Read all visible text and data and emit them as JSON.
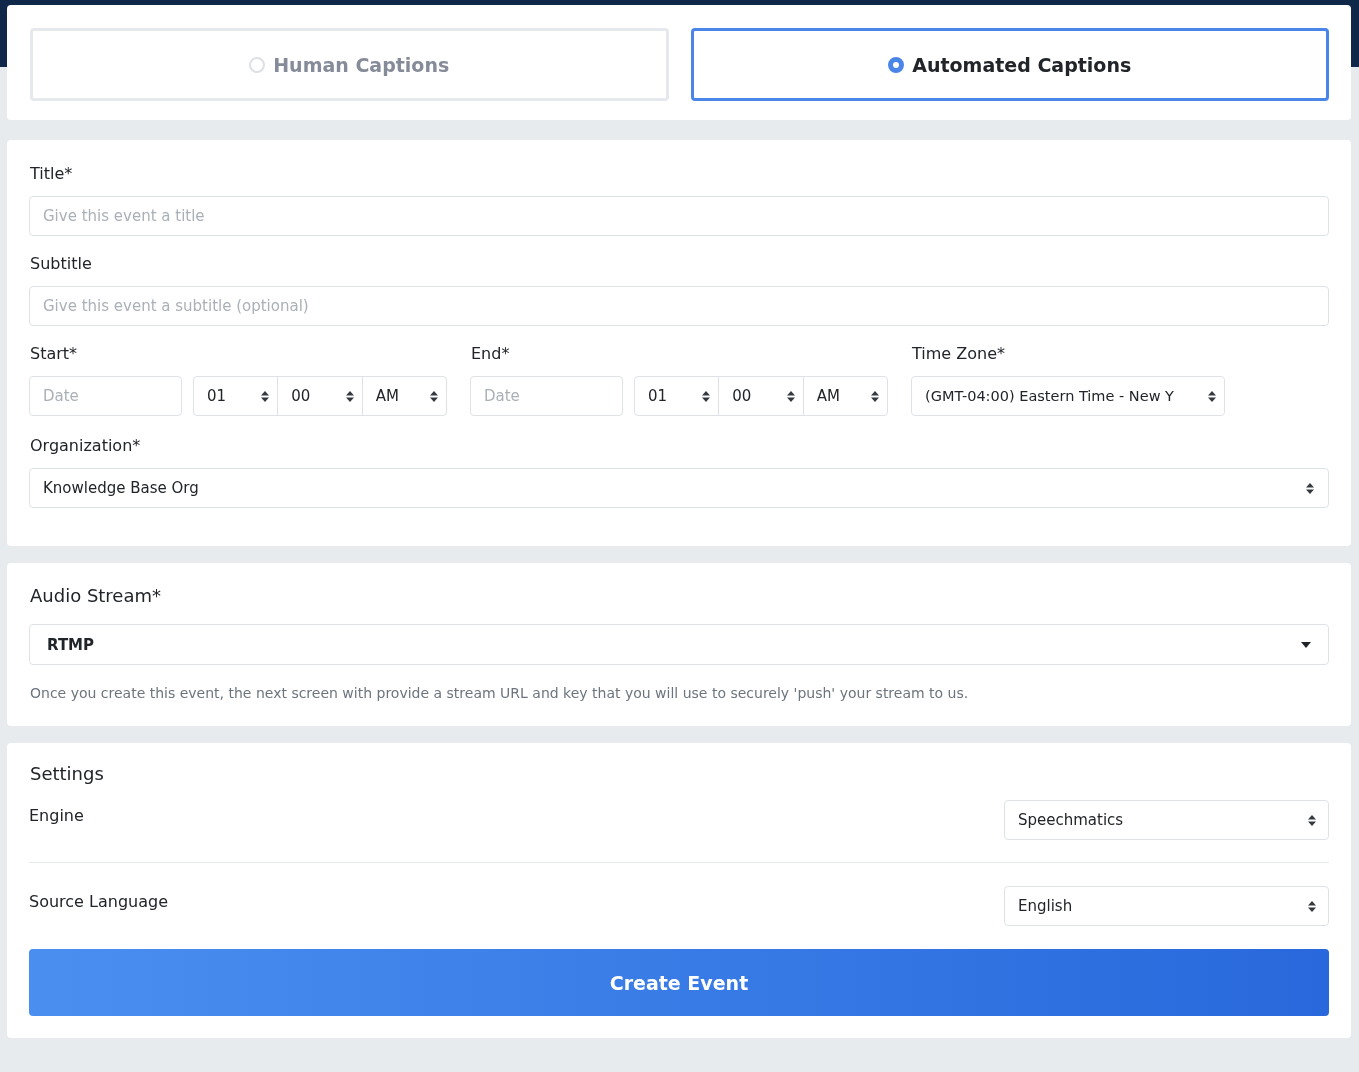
{
  "caption_types": [
    {
      "label": "Human Captions",
      "selected": false
    },
    {
      "label": "Automated Captions",
      "selected": true
    }
  ],
  "details": {
    "title": {
      "label": "Title*",
      "placeholder": "Give this event a title"
    },
    "subtitle": {
      "label": "Subtitle",
      "placeholder": "Give this event a subtitle (optional)"
    },
    "start": {
      "label": "Start*",
      "date_placeholder": "Date",
      "hour": "01",
      "minute": "00",
      "period": "AM"
    },
    "end": {
      "label": "End*",
      "date_placeholder": "Date",
      "hour": "01",
      "minute": "00",
      "period": "AM"
    },
    "time_zone": {
      "label": "Time Zone*",
      "value": "(GMT-04:00) Eastern Time - New Y"
    },
    "organization": {
      "label": "Organization*",
      "value": "Knowledge Base Org"
    }
  },
  "audio_stream": {
    "heading": "Audio Stream*",
    "value": "RTMP",
    "help": "Once you create this event, the next screen with provide a stream URL and key that you will use to securely 'push' your stream to us."
  },
  "settings": {
    "heading": "Settings",
    "rows": [
      {
        "label": "Engine",
        "value": "Speechmatics"
      },
      {
        "label": "Source Language",
        "value": "English"
      }
    ]
  },
  "submit": "Create Event"
}
